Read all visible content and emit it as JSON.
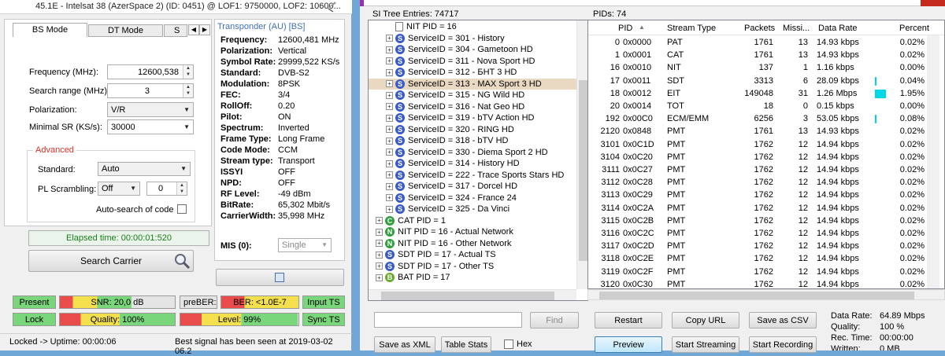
{
  "left": {
    "title_text": "45.1E - Intelsat 38 (AzerSpace 2) (ID: 0451) @ LOF1: 9750000, LOF2: 10600...",
    "tabs": [
      "BS Mode",
      "DT Mode",
      "S"
    ],
    "fields": {
      "frequency_label": "Frequency (MHz):",
      "frequency_value": "12600,538",
      "search_range_label": "Search range (MHz):",
      "search_range_value": "3",
      "polarization_label": "Polarization:",
      "polarization_value": "V/R",
      "min_sr_label": "Minimal SR (KS/s):",
      "min_sr_value": "30000"
    },
    "advanced": {
      "title": "Advanced",
      "standard_label": "Standard:",
      "standard_value": "Auto",
      "pls_label": "PL Scrambling:",
      "pls_mode": "Off",
      "pls_value": "0",
      "autosearch_label": "Auto-search of code"
    },
    "elapsed": "Elapsed time: 00:00:01:520",
    "search_button": "Search Carrier",
    "transponder": {
      "title": "Transponder (AU) [BS]",
      "rows": [
        {
          "k": "Frequency:",
          "v": "12600,481 MHz"
        },
        {
          "k": "Polarization:",
          "v": "Vertical"
        },
        {
          "k": "Symbol Rate:",
          "v": "29999,522 KS/s"
        },
        {
          "k": "Standard:",
          "v": "DVB-S2"
        },
        {
          "k": "Modulation:",
          "v": "8PSK"
        },
        {
          "k": "FEC:",
          "v": "3/4"
        },
        {
          "k": "RollOff:",
          "v": "0.20"
        },
        {
          "k": "Pilot:",
          "v": "ON"
        },
        {
          "k": "Spectrum:",
          "v": "Inverted"
        },
        {
          "k": "Frame Type:",
          "v": "Long Frame"
        },
        {
          "k": "Code Mode:",
          "v": "CCM"
        },
        {
          "k": "Stream type:",
          "v": "Transport"
        },
        {
          "k": "ISSYI",
          "v": "OFF"
        },
        {
          "k": "NPD:",
          "v": "OFF"
        },
        {
          "k": "RF Level:",
          "v": "-49 dBm"
        },
        {
          "k": "BitRate:",
          "v": "65,302 Mbit/s"
        },
        {
          "k": "CarrierWidth:",
          "v": "35,998 MHz"
        }
      ],
      "mis_label": "MIS (0):",
      "mis_value": "Single"
    },
    "status": {
      "present": "Present",
      "snr": "SNR: 20,0 dB",
      "preber": "preBER: <1....",
      "ber": "BER: <1.0E-7",
      "input_ts": "Input TS",
      "lock": "Lock",
      "quality": "Quality: 100%",
      "level": "Level: 99%",
      "sync_ts": "Sync TS",
      "snr_fill": 0.62,
      "quality_fill": 1.0,
      "level_fill": 0.99
    },
    "footer_left": "Locked -> Uptime: 00:00:06",
    "footer_right": "Best signal has been seen at 2019-03-02 06.2"
  },
  "si": {
    "header": "SI Tree Entries: 74717",
    "rows": [
      {
        "t": "NIT PID = 16",
        "ic": "doc",
        "exp": "",
        "ind": 1
      },
      {
        "t": "ServiceID = 301 - History",
        "ic": "S",
        "exp": "+",
        "ind": 1
      },
      {
        "t": "ServiceID = 304 - Gametoon HD",
        "ic": "S",
        "exp": "+",
        "ind": 1
      },
      {
        "t": "ServiceID = 311 - Nova Sport HD",
        "ic": "S",
        "exp": "+",
        "ind": 1
      },
      {
        "t": "ServiceID = 312 - БНТ 3 HD",
        "ic": "S",
        "exp": "+",
        "ind": 1
      },
      {
        "t": "ServiceID = 313 - MAX Sport 3 HD",
        "ic": "S",
        "exp": "+",
        "ind": 1,
        "sel": true
      },
      {
        "t": "ServiceID = 315 - NG Wild HD",
        "ic": "S",
        "exp": "+",
        "ind": 1
      },
      {
        "t": "ServiceID = 316 - Nat Geo HD",
        "ic": "S",
        "exp": "+",
        "ind": 1
      },
      {
        "t": "ServiceID = 319 - bTV Action HD",
        "ic": "S",
        "exp": "+",
        "ind": 1
      },
      {
        "t": "ServiceID = 320 - RING HD",
        "ic": "S",
        "exp": "+",
        "ind": 1
      },
      {
        "t": "ServiceID = 318 - bTV HD",
        "ic": "S",
        "exp": "+",
        "ind": 1
      },
      {
        "t": "ServiceID = 330 - Diema Sport 2 HD",
        "ic": "S",
        "exp": "+",
        "ind": 1
      },
      {
        "t": "ServiceID = 314 - History HD",
        "ic": "S",
        "exp": "+",
        "ind": 1
      },
      {
        "t": "ServiceID = 222 - Trace Sports Stars HD",
        "ic": "S",
        "exp": "+",
        "ind": 1
      },
      {
        "t": "ServiceID = 317 - Dorcel HD",
        "ic": "S",
        "exp": "+",
        "ind": 1
      },
      {
        "t": "ServiceID = 324 - France 24",
        "ic": "S",
        "exp": "+",
        "ind": 1
      },
      {
        "t": "ServiceID = 325 - Da Vinci",
        "ic": "S",
        "exp": "+",
        "ind": 1
      },
      {
        "t": "CAT PID = 1",
        "ic": "C",
        "exp": "+",
        "ind": 0
      },
      {
        "t": "NIT PID = 16 - Actual Network",
        "ic": "N",
        "exp": "+",
        "ind": 0
      },
      {
        "t": "NIT PID = 16 - Other Network",
        "ic": "N",
        "exp": "+",
        "ind": 0
      },
      {
        "t": "SDT PID = 17 - Actual TS",
        "ic": "S",
        "exp": "+",
        "ind": 0
      },
      {
        "t": "SDT PID = 17 - Other TS",
        "ic": "S",
        "exp": "+",
        "ind": 0
      },
      {
        "t": "BAT PID = 17",
        "ic": "B",
        "exp": "+",
        "ind": 0
      }
    ],
    "find_placeholder": "",
    "find_button": "Find",
    "save_xml": "Save as XML",
    "table_stats": "Table Stats",
    "hex_label": "Hex"
  },
  "pids": {
    "header": "PIDs: 74",
    "columns": [
      "PID",
      "Stream Type",
      "Packets",
      "Missi...",
      "Data Rate",
      "Percent"
    ],
    "rows": [
      {
        "pid": "0",
        "hex": "0x0000",
        "type": "PAT",
        "packets": "1761",
        "miss": "13",
        "rate": "14.93 kbps",
        "pct": "0.02%",
        "bar": 0
      },
      {
        "pid": "1",
        "hex": "0x0001",
        "type": "CAT",
        "packets": "1761",
        "miss": "13",
        "rate": "14.93 kbps",
        "pct": "0.02%",
        "bar": 0
      },
      {
        "pid": "16",
        "hex": "0x0010",
        "type": "NIT",
        "packets": "137",
        "miss": "1",
        "rate": "1.16 kbps",
        "pct": "0.00%",
        "bar": 0
      },
      {
        "pid": "17",
        "hex": "0x0011",
        "type": "SDT",
        "packets": "3313",
        "miss": "6",
        "rate": "28.09 kbps",
        "pct": "0.04%",
        "bar": 0.05
      },
      {
        "pid": "18",
        "hex": "0x0012",
        "type": "EIT",
        "packets": "149048",
        "miss": "31",
        "rate": "1.26 Mbps",
        "pct": "1.95%",
        "bar": 1
      },
      {
        "pid": "20",
        "hex": "0x0014",
        "type": "TOT",
        "packets": "18",
        "miss": "0",
        "rate": "0.15 kbps",
        "pct": "0.00%",
        "bar": 0
      },
      {
        "pid": "192",
        "hex": "0x00C0",
        "type": "ECM/EMM",
        "packets": "6256",
        "miss": "3",
        "rate": "53.05 kbps",
        "pct": "0.08%",
        "bar": 0.05
      },
      {
        "pid": "2120",
        "hex": "0x0848",
        "type": "PMT",
        "packets": "1761",
        "miss": "13",
        "rate": "14.93 kbps",
        "pct": "0.02%",
        "bar": 0
      },
      {
        "pid": "3101",
        "hex": "0x0C1D",
        "type": "PMT",
        "packets": "1762",
        "miss": "12",
        "rate": "14.94 kbps",
        "pct": "0.02%",
        "bar": 0
      },
      {
        "pid": "3104",
        "hex": "0x0C20",
        "type": "PMT",
        "packets": "1762",
        "miss": "12",
        "rate": "14.94 kbps",
        "pct": "0.02%",
        "bar": 0
      },
      {
        "pid": "3111",
        "hex": "0x0C27",
        "type": "PMT",
        "packets": "1762",
        "miss": "12",
        "rate": "14.94 kbps",
        "pct": "0.02%",
        "bar": 0
      },
      {
        "pid": "3112",
        "hex": "0x0C28",
        "type": "PMT",
        "packets": "1762",
        "miss": "12",
        "rate": "14.94 kbps",
        "pct": "0.02%",
        "bar": 0
      },
      {
        "pid": "3113",
        "hex": "0x0C29",
        "type": "PMT",
        "packets": "1762",
        "miss": "12",
        "rate": "14.94 kbps",
        "pct": "0.02%",
        "bar": 0
      },
      {
        "pid": "3114",
        "hex": "0x0C2A",
        "type": "PMT",
        "packets": "1762",
        "miss": "12",
        "rate": "14.94 kbps",
        "pct": "0.02%",
        "bar": 0
      },
      {
        "pid": "3115",
        "hex": "0x0C2B",
        "type": "PMT",
        "packets": "1762",
        "miss": "12",
        "rate": "14.94 kbps",
        "pct": "0.02%",
        "bar": 0
      },
      {
        "pid": "3116",
        "hex": "0x0C2C",
        "type": "PMT",
        "packets": "1762",
        "miss": "12",
        "rate": "14.94 kbps",
        "pct": "0.02%",
        "bar": 0
      },
      {
        "pid": "3117",
        "hex": "0x0C2D",
        "type": "PMT",
        "packets": "1762",
        "miss": "12",
        "rate": "14.94 kbps",
        "pct": "0.02%",
        "bar": 0
      },
      {
        "pid": "3118",
        "hex": "0x0C2E",
        "type": "PMT",
        "packets": "1762",
        "miss": "12",
        "rate": "14.94 kbps",
        "pct": "0.02%",
        "bar": 0
      },
      {
        "pid": "3119",
        "hex": "0x0C2F",
        "type": "PMT",
        "packets": "1762",
        "miss": "12",
        "rate": "14.94 kbps",
        "pct": "0.02%",
        "bar": 0
      },
      {
        "pid": "3120",
        "hex": "0x0C30",
        "type": "PMT",
        "packets": "1762",
        "miss": "12",
        "rate": "14.94 kbps",
        "pct": "0.02%",
        "bar": 0
      }
    ],
    "buttons": {
      "restart": "Restart",
      "copy_url": "Copy URL",
      "save_csv": "Save as CSV",
      "preview": "Preview",
      "start_streaming": "Start Streaming",
      "start_recording": "Start Recording"
    },
    "summary": [
      {
        "k": "Data Rate:",
        "v": "64.89 Mbps"
      },
      {
        "k": "Quality:",
        "v": "100 %"
      },
      {
        "k": "Rec. Time:",
        "v": "00:00:00"
      },
      {
        "k": "Written:",
        "v": "0 MB"
      }
    ]
  },
  "colors": {
    "accent_cyan": "#00d8e8",
    "status_green": "#7ad67a",
    "status_red": "#ea4b4b",
    "status_yellow": "#f4e04c",
    "selection": "#e9d9c2"
  },
  "icons": [
    "app-icon",
    "satellite-dish-icon",
    "search-icon",
    "list-icon",
    "close-icon",
    "sort-arrow-icon",
    "dropdown-arrow-icon"
  ]
}
